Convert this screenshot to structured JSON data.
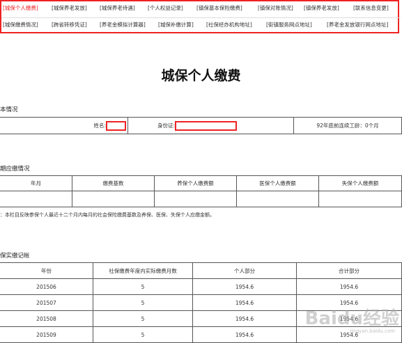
{
  "nav": {
    "row1": [
      "[城保个人缴费]",
      "[城保养老发放]",
      "[城保养老待遇]",
      "[个人权益记录]",
      "[镇保基本保险缴费]",
      "[镇保对账情况]",
      "[镇保养老发放]",
      "[联系信息变更]"
    ],
    "row2": [
      "[城保缴费情况]",
      "[跨省转移凭证]",
      "[养老金模拟计算器]",
      "[城保补缴计算]",
      "[社保经办机构地址]",
      "[街镇服务网点地址]",
      "[养老金发放银行网点地址]"
    ]
  },
  "page_title": "城保个人缴费",
  "basic": {
    "heading": "本情况",
    "name_label": "姓名:",
    "id_label": "身份证:",
    "years_text": "92年底前连续工龄：0个月"
  },
  "due": {
    "heading": "期应缴情况",
    "headers": [
      "年月",
      "缴费基数",
      "养保个人缴费额",
      "医保个人缴费额",
      "失保个人缴费额"
    ],
    "note": "：本栏目反映参保个人最近十二个月内每月的社会保险缴费基数及养保、医保、失保个人应缴金额。"
  },
  "actual": {
    "heading": "保实缴记帐",
    "headers": [
      "年份",
      "社保缴费年度内实际缴费月数",
      "个人部分",
      "合计部分"
    ],
    "rows": [
      [
        "201506",
        "5",
        "1954.6",
        "1954.6"
      ],
      [
        "201507",
        "5",
        "1954.6",
        "1954.6"
      ],
      [
        "201508",
        "5",
        "1954.6",
        "1954.6"
      ],
      [
        "201509",
        "5",
        "1954.6",
        "1954.6"
      ]
    ]
  },
  "watermark": {
    "main": "Baidu经验",
    "sub": "jingyan.baidu.com"
  }
}
